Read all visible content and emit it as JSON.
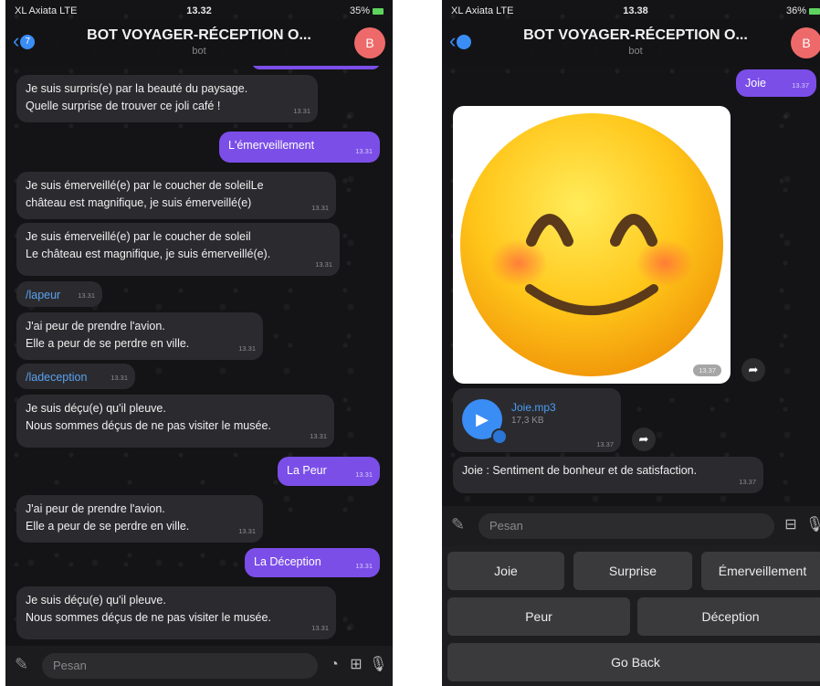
{
  "left": {
    "status": {
      "carrier": "XL Axiata  LTE",
      "time": "13.32",
      "battery": "35%"
    },
    "header": {
      "back_count": "7",
      "title": "BOT VOYAGER-RÉCEPTION O...",
      "subtitle": "bot",
      "avatar": "B"
    },
    "messages": [
      {
        "text": "Je suis surpris(e) par la beauté du paysage.\nQuelle surprise de trouver ce joli café !",
        "time": "13.31"
      },
      {
        "text": "L'émerveillement",
        "time": "13.31"
      },
      {
        "text": "Je suis émerveillé(e) par le coucher de soleilLe\nchâteau est magnifique, je suis émerveillé(e)",
        "time": "13.31"
      },
      {
        "text": "Je suis émerveillé(e) par le coucher de soleil\nLe château est magnifique, je suis émerveillé(e).",
        "time": "13.31"
      },
      {
        "text": "/lapeur",
        "time": "13.31"
      },
      {
        "text": "J'ai peur de prendre l'avion.\nElle a peur de se perdre en ville.",
        "time": "13.31"
      },
      {
        "text": "/ladeception",
        "time": "13.31"
      },
      {
        "text": "Je suis déçu(e) qu'il pleuve.\nNous sommes déçus de ne pas visiter le musée.",
        "time": "13.31"
      },
      {
        "text": "La Peur",
        "time": "13.31"
      },
      {
        "text": "J'ai peur de prendre l'avion.\nElle a peur de se perdre en ville.",
        "time": "13.31"
      },
      {
        "text": "La Déception",
        "time": "13.31"
      },
      {
        "text": "Je suis déçu(e) qu'il pleuve.\nNous sommes déçus de ne pas visiter le musée.",
        "time": "13.31"
      }
    ],
    "input": {
      "placeholder": "Pesan"
    }
  },
  "right": {
    "status": {
      "carrier": "XL Axiata  LTE",
      "time": "13.38",
      "battery": "36%"
    },
    "header": {
      "title": "BOT VOYAGER-RÉCEPTION O...",
      "subtitle": "bot",
      "avatar": "B"
    },
    "joie_msg": {
      "text": "Joie",
      "time": "13.37"
    },
    "image_time": "13.37",
    "audio": {
      "name": "Joie.mp3",
      "size": "17,3 KB",
      "time": "13.37"
    },
    "caption": {
      "text": "Joie : Sentiment de bonheur et de satisfaction.",
      "time": "13.37"
    },
    "input": {
      "placeholder": "Pesan"
    },
    "keyboard": {
      "joie": "Joie",
      "surprise": "Surprise",
      "emerveillement": "Émerveillement",
      "peur": "Peur",
      "deception": "Déception",
      "go_back": "Go Back"
    }
  }
}
